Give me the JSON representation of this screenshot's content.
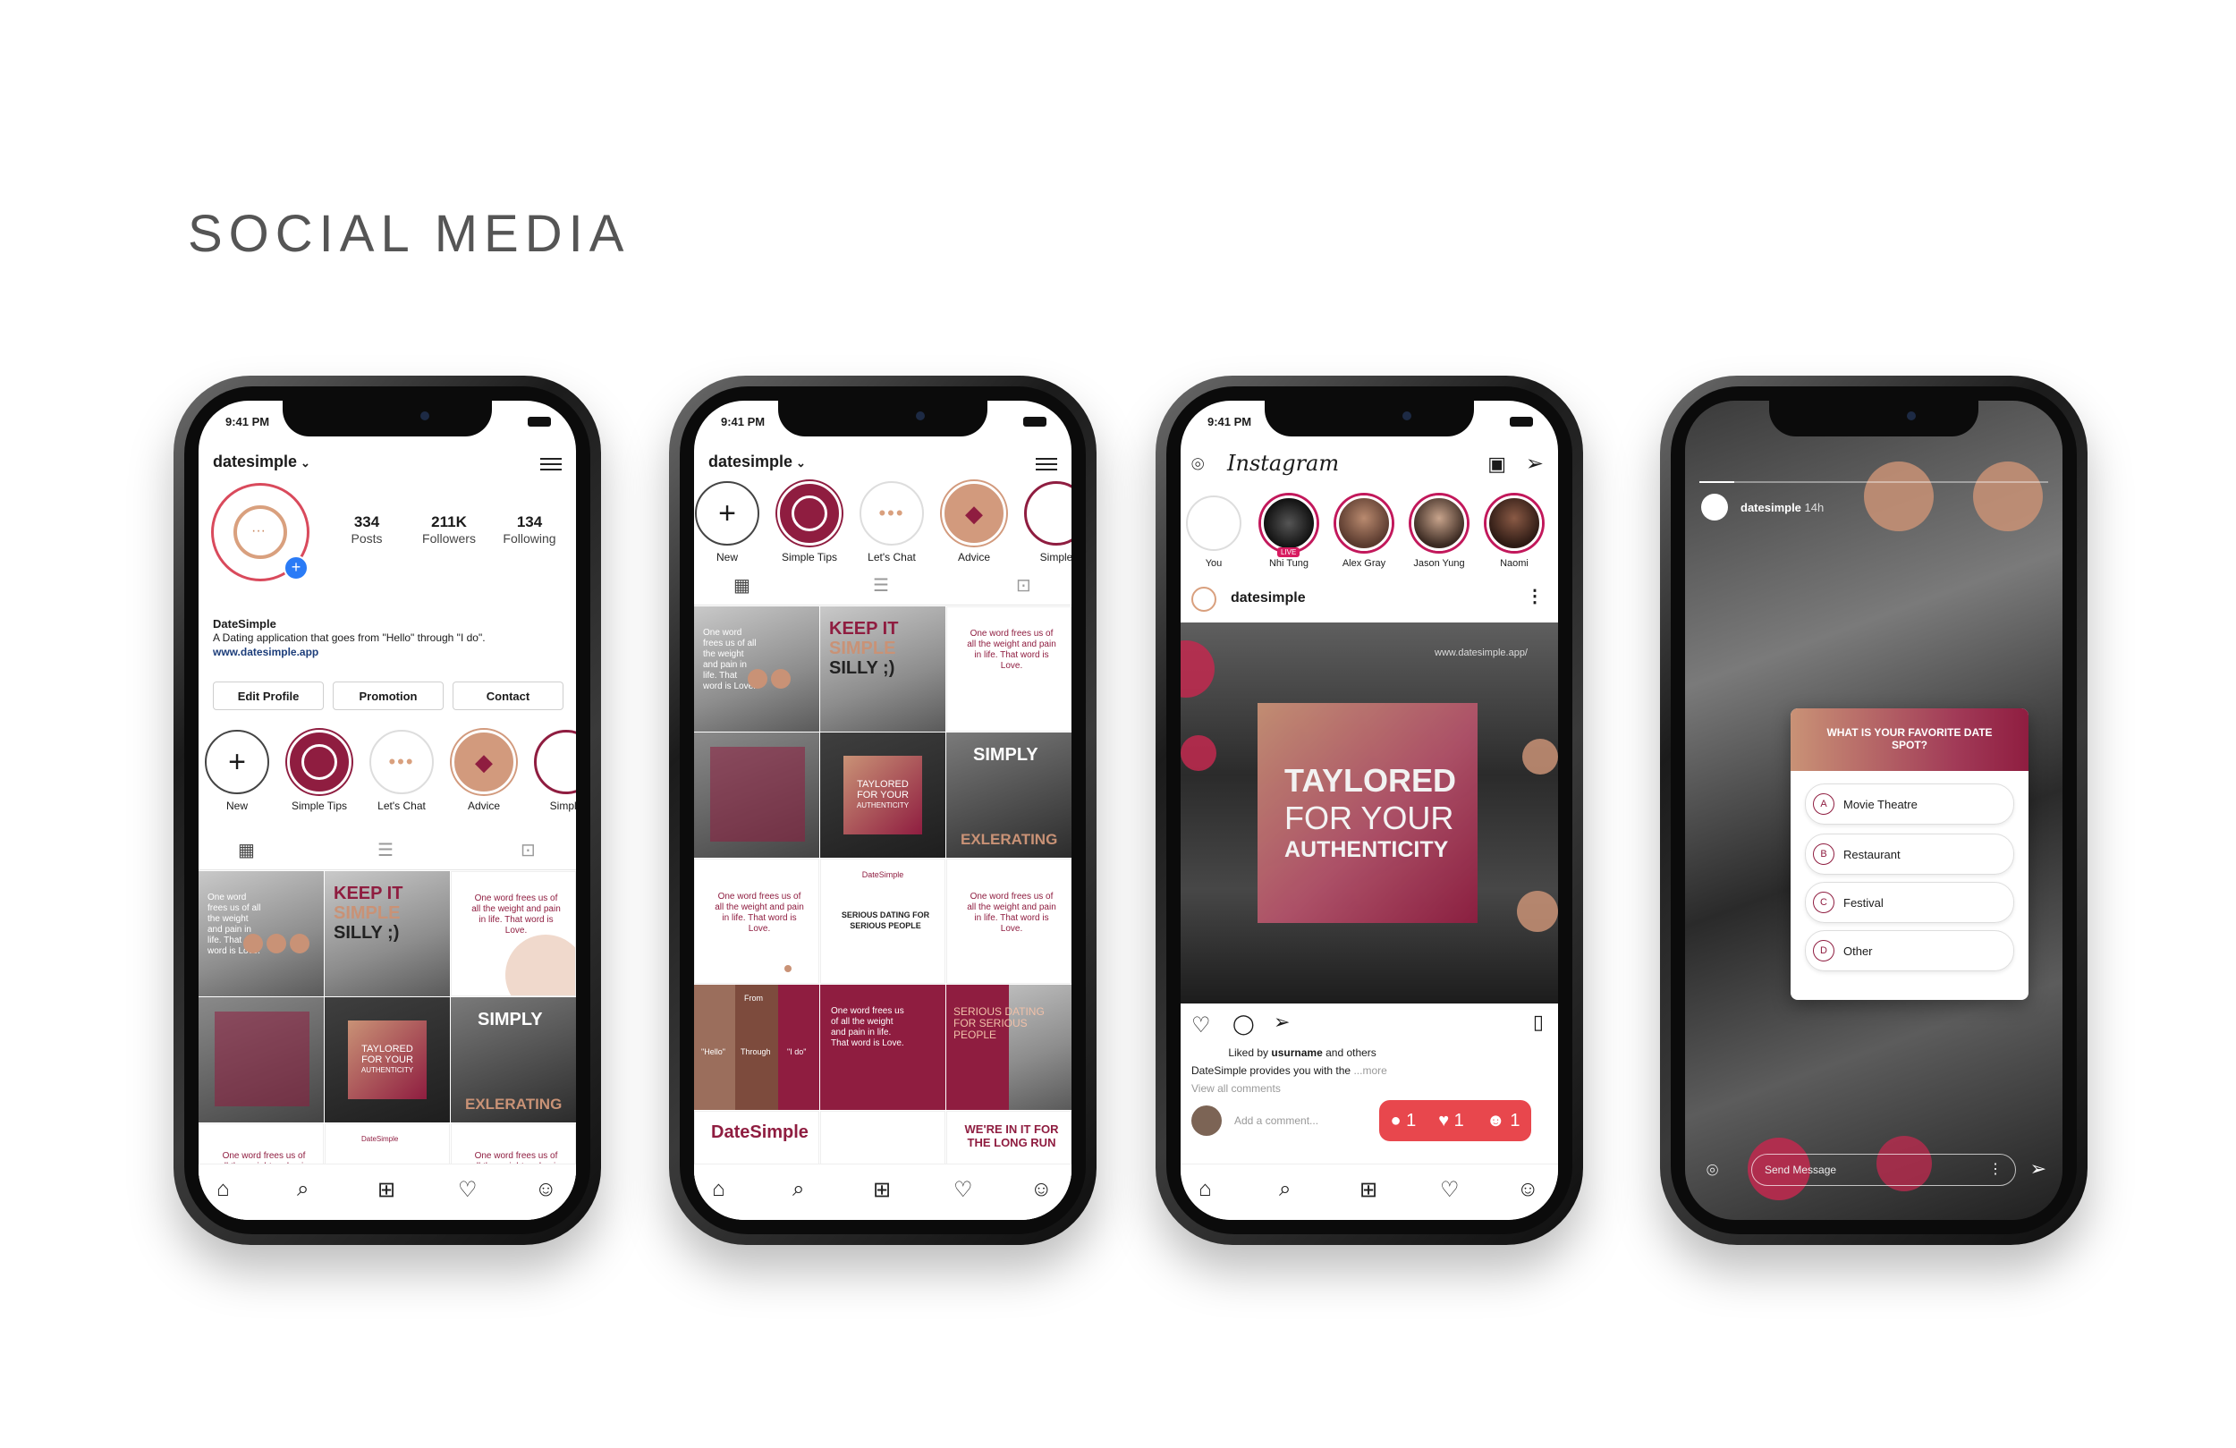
{
  "title": "SOCIAL MEDIA",
  "status_time": "9:41 PM",
  "colors": {
    "brand_wine": "#8f1d40",
    "brand_tan": "#c99276",
    "notif_red": "#e8474d"
  },
  "profile": {
    "username": "datesimple",
    "stats": [
      {
        "value": "334",
        "label": "Posts"
      },
      {
        "value": "211K",
        "label": "Followers"
      },
      {
        "value": "134",
        "label": "Following"
      }
    ],
    "name": "DateSimple",
    "bio": "A Dating application that goes from \"Hello\" through \"I do\".",
    "link": "www.datesimple.app",
    "buttons": [
      "Edit Profile",
      "Promotion",
      "Contact"
    ],
    "highlights": [
      "New",
      "Simple Tips",
      "Let's Chat",
      "Advice",
      "Simple"
    ]
  },
  "tiles": {
    "keep_it": [
      "KEEP IT",
      "SIMPLE",
      "SILLY ;)"
    ],
    "quote": "One word frees us of all the weight and pain in life. That word is Love.",
    "simply": "SIMPLY",
    "exlerating": "EXLERATING",
    "taylored_small": [
      "TAYLORED",
      "FOR YOUR",
      "AUTHENTICITY"
    ],
    "serious": "SERIOUS DATING FOR SERIOUS PEOPLE",
    "from": "From",
    "through": "Through",
    "hello": "\"Hello\"",
    "ido": "\"I do\"",
    "datesimple_wordmark": "DateSimple",
    "long_run": "WE'RE IN IT FOR THE LONG RUN"
  },
  "feed": {
    "logo": "Instagram",
    "stories": [
      {
        "name": "You"
      },
      {
        "name": "Nhi Tung",
        "badge": "LIVE"
      },
      {
        "name": "Alex Gray"
      },
      {
        "name": "Jason Yung"
      },
      {
        "name": "Naomi"
      }
    ],
    "post_user": "datesimple",
    "post_url": "www.datesimple.app/",
    "overlay": [
      "TAYLORED",
      "FOR YOUR",
      "AUTHENTICITY"
    ],
    "liked_by": "Liked by",
    "liked_user": "usurname",
    "liked_others": "and others",
    "caption_user": "DateSimple",
    "caption": "provides you with the",
    "more": "...more",
    "view_comments": "View all comments",
    "add_comment": "Add a comment...",
    "notif": {
      "comments": "1",
      "likes": "1",
      "follows": "1"
    }
  },
  "story": {
    "user": "datesimple",
    "time": "14h",
    "question": "WHAT IS YOUR FAVORITE DATE SPOT?",
    "options": [
      {
        "letter": "A",
        "label": "Movie Theatre"
      },
      {
        "letter": "B",
        "label": "Restaurant"
      },
      {
        "letter": "C",
        "label": "Festival"
      },
      {
        "letter": "D",
        "label": "Other"
      }
    ],
    "send_placeholder": "Send Message"
  }
}
